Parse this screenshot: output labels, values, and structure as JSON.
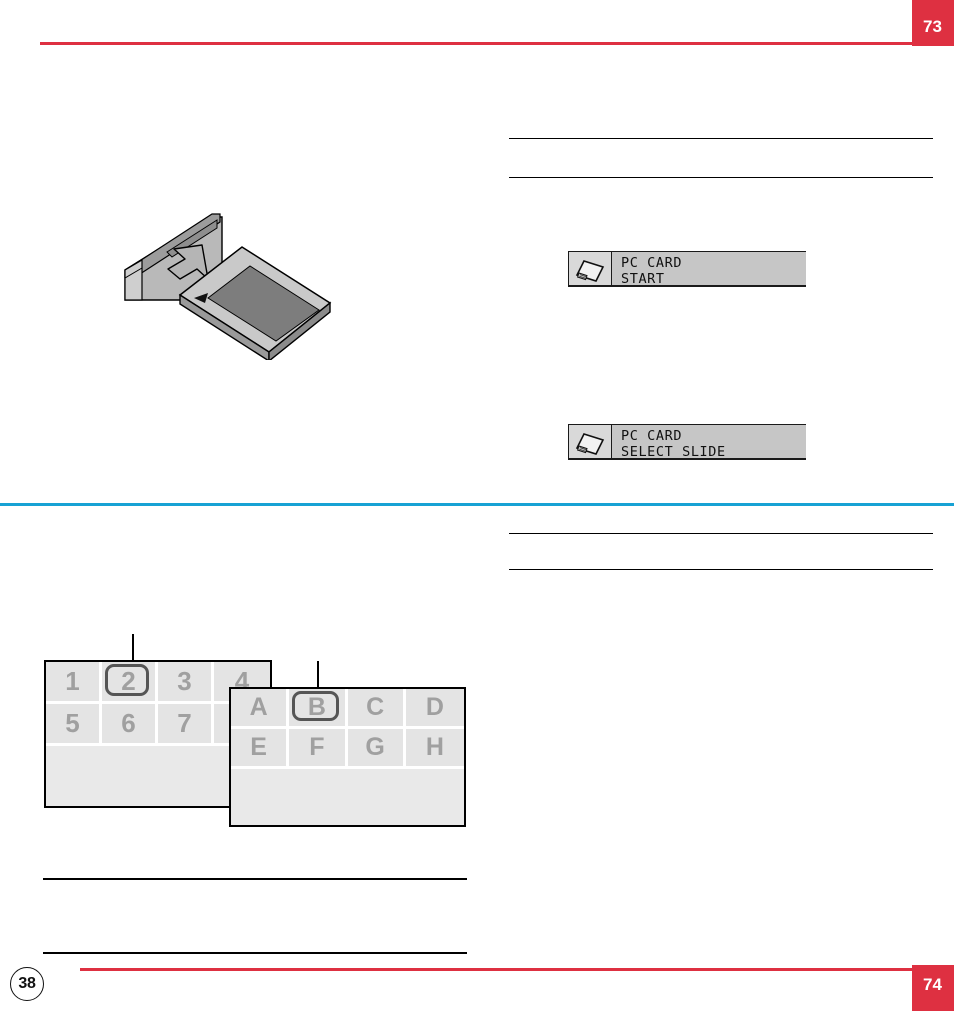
{
  "document": {
    "left_page_number": "38",
    "top_tab_number": "73",
    "bottom_tab_number": "74"
  },
  "colors": {
    "accent_red": "#DE3041",
    "accent_teal": "#17A2D4",
    "osd_background": "#C6C6C6",
    "thumbnail_cell": "#E4E4E4",
    "thumbnail_digit": "#A0A0A0",
    "selection_ring": "#555555"
  },
  "illustration": {
    "name": "pc-card-insertion-diagram",
    "caption": "",
    "parts": {
      "slot": "projector card slot",
      "card": "PC card",
      "arrow": "insertion direction arrow",
      "card_notch": "orientation triangle"
    }
  },
  "osd_messages": [
    {
      "icon": "pc-card-icon",
      "line1": "PC CARD",
      "line2": "START"
    },
    {
      "icon": "pc-card-icon",
      "line1": "PC CARD",
      "line2": "SELECT SLIDE"
    }
  ],
  "thumbnail_panels": [
    {
      "name": "slide-index-numbers",
      "selected": "2",
      "cells": [
        "1",
        "2",
        "3",
        "4",
        "5",
        "6",
        "7",
        ""
      ]
    },
    {
      "name": "slide-index-letters",
      "selected": "B",
      "cells": [
        "A",
        "B",
        "C",
        "D",
        "E",
        "F",
        "G",
        "H"
      ]
    }
  ]
}
